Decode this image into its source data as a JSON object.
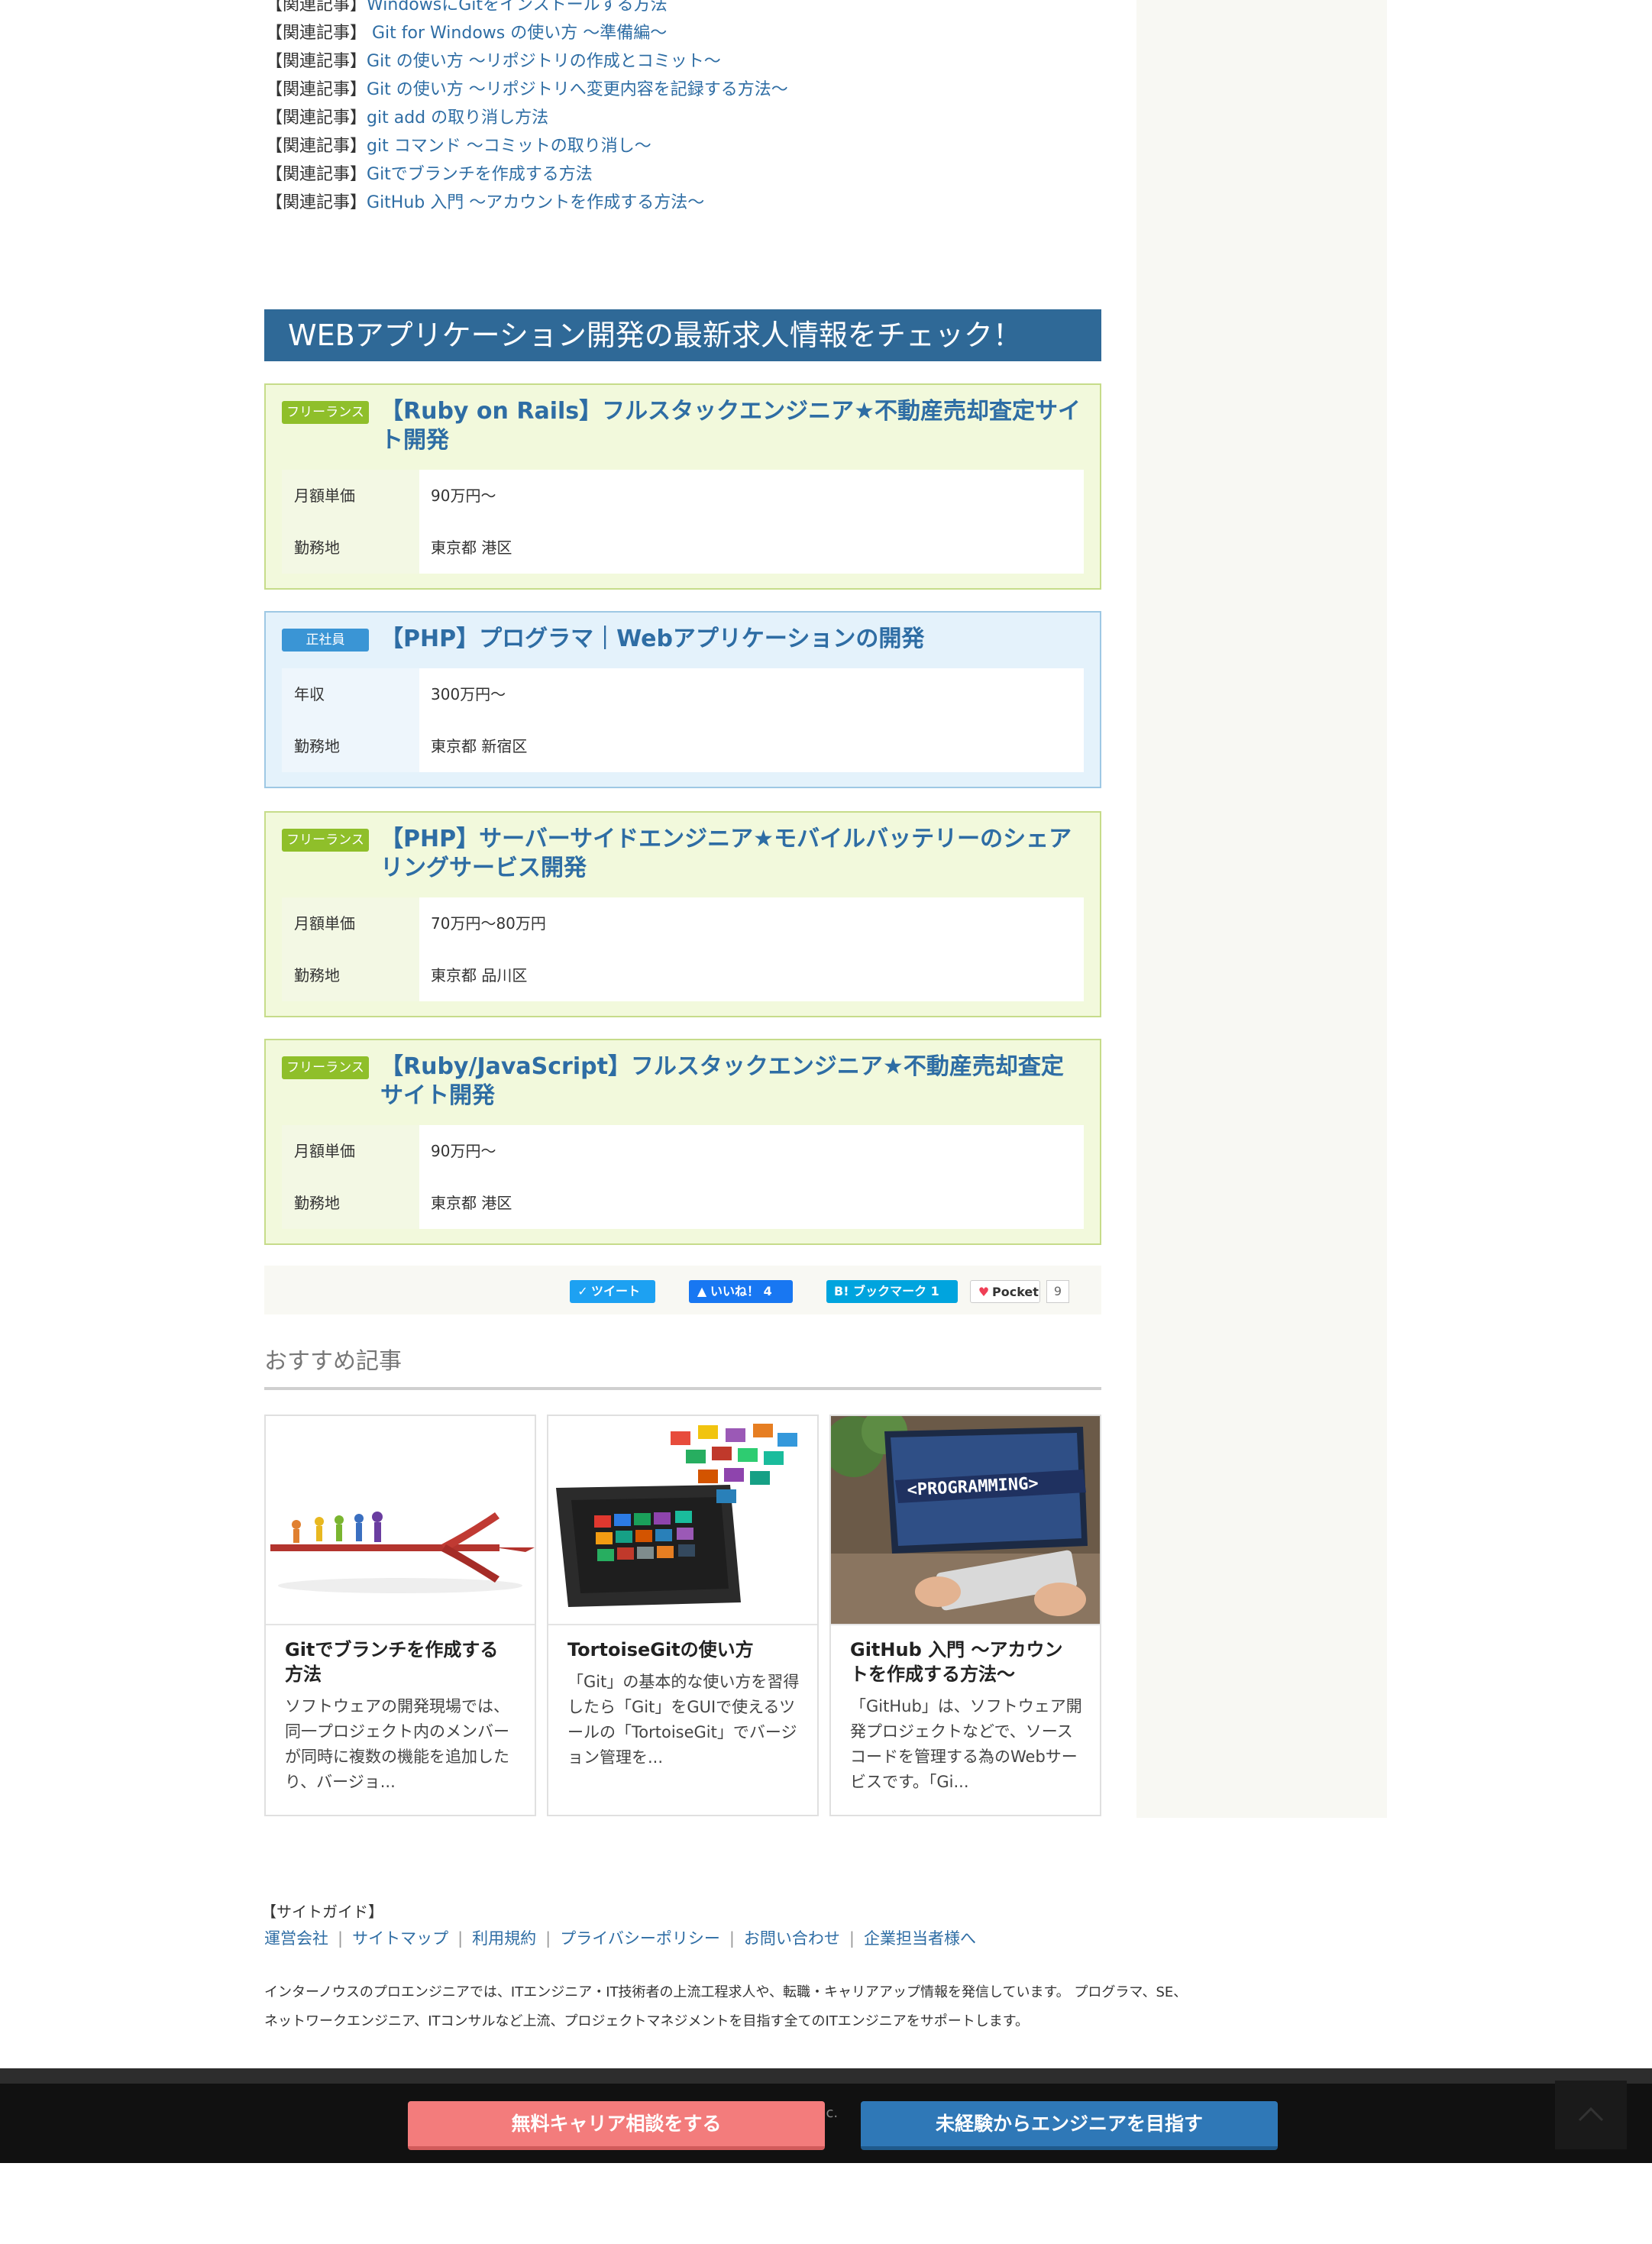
{
  "related_articles": [
    {
      "prefix": "【関連記事】",
      "link": "WindowsにGitをインストールする方法"
    },
    {
      "prefix": "【関連記事】",
      "link": " Git for Windows の使い方 ～準備編～"
    },
    {
      "prefix": "【関連記事】",
      "link": "Git の使い方 ～リポジトリの作成とコミット～"
    },
    {
      "prefix": "【関連記事】",
      "link": "Git の使い方 ～リポジトリへ変更内容を記録する方法～"
    },
    {
      "prefix": "【関連記事】",
      "link": "git add の取り消し方法"
    },
    {
      "prefix": "【関連記事】",
      "link": "git コマンド ～コミットの取り消し～"
    },
    {
      "prefix": "【関連記事】",
      "link": "Gitでブランチを作成する方法"
    },
    {
      "prefix": "【関連記事】",
      "link": "GitHub 入門 ～アカウントを作成する方法～"
    }
  ],
  "jobs": {
    "heading": "WEBアプリケーション開発の最新求人情報をチェック！",
    "items": [
      {
        "badge": "フリーランス",
        "title": "【Ruby on Rails】フルスタックエンジニア★不動産売却査定サイト開発",
        "label1": "月額単価",
        "value1": "90万円～",
        "label2": "勤務地",
        "value2": "東京都 港区"
      },
      {
        "badge": "正社員",
        "title": "【PHP】プログラマ｜Webアプリケーションの開発",
        "label1": "年収",
        "value1": "300万円～",
        "label2": "勤務地",
        "value2": "東京都 新宿区"
      },
      {
        "badge": "フリーランス",
        "title": "【PHP】サーバーサイドエンジニア★モバイルバッテリーのシェアリングサービス開発",
        "label1": "月額単価",
        "value1": "70万円～80万円",
        "label2": "勤務地",
        "value2": "東京都 品川区"
      },
      {
        "badge": "フリーランス",
        "title": "【Ruby/JavaScript】フルスタックエンジニア★不動産売却査定サイト開発",
        "label1": "月額単価",
        "value1": "90万円～",
        "label2": "勤務地",
        "value2": "東京都 港区"
      }
    ]
  },
  "share": {
    "tweet": "ツイート",
    "like": "いいね！ 4",
    "bookmark": "B! ブックマーク 1",
    "pocket": "Pocket",
    "pocket_count": "9"
  },
  "recommended": {
    "heading": "おすすめ記事",
    "cards": [
      {
        "title": "Gitでブランチを作成する方法",
        "desc": "ソフトウェアの開発現場では、同一プロジェクト内のメンバーが同時に複数の機能を追加したり、バージョ..."
      },
      {
        "title": "TortoiseGitの使い方",
        "desc": "「Git」の基本的な使い方を習得したら「Git」をGUIで使えるツールの「TortoiseGit」でバージョン管理を..."
      },
      {
        "title": "GitHub 入門 ～アカウントを作成する方法～",
        "desc": "「GitHub」は、ソフトウェア開発プロジェクトなどで、ソースコードを管理する為のWebサービスです。「Gi..."
      }
    ],
    "programming_text": "<PROGRAMMING>"
  },
  "footer": {
    "guide_title": "【サイトガイド】",
    "links": [
      "運営会社",
      "サイトマップ",
      "利用規約",
      "プライバシーポリシー",
      "お問い合わせ",
      "企業担当者様へ"
    ],
    "desc_line1": "インターノウスのプロエンジニアでは、ITエンジニア・IT技術者の上流工程求人や、転職・キャリアアップ情報を発信しています。 プログラマ、SE、",
    "desc_line2": "ネットワークエンジニア、ITコンサルなど上流、プロジェクトマネジメントを目指す全てのITエンジニアをサポートします。",
    "copyright_fragment": "s,inc."
  },
  "cta": {
    "career": "無料キャリア相談をする",
    "newbie": "未経験からエンジニアを目指す"
  },
  "colors": {
    "link": "#2e6da4",
    "heading_bg": "#2f6997",
    "freelance_badge": "#8fbf2a",
    "fulltime_badge": "#3a95d5",
    "cta_career": "#f37c7c",
    "cta_newbie": "#2f78b7"
  },
  "icons": {
    "tweet": "twitter-bird-icon",
    "like": "thumbs-up-icon",
    "pocket": "pocket-icon",
    "page_top": "chevron-up-icon"
  }
}
